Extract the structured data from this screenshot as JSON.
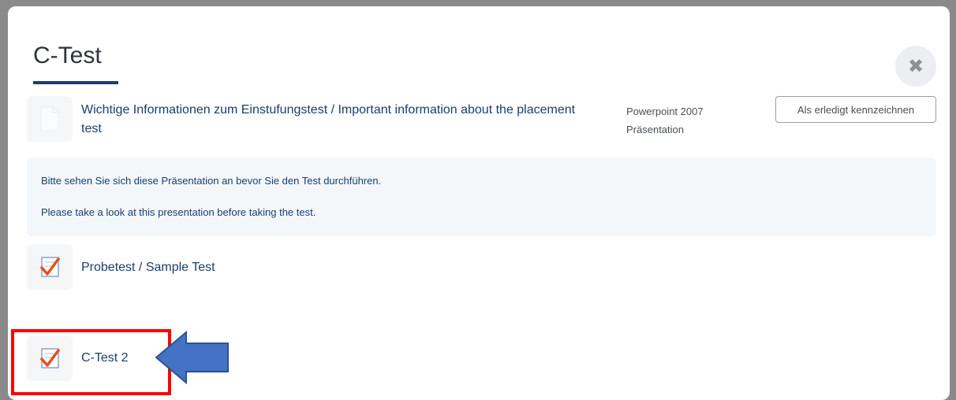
{
  "modal": {
    "title": "C-Test",
    "close_icon": "close-icon"
  },
  "activities": [
    {
      "icon": "powerpoint-file-icon",
      "title": "Wichtige Informationen zum Einstufungstest / Important information about the placement test",
      "meta_line1": "Powerpoint 2007",
      "meta_line2": "Präsentation",
      "button_label": "Als erledigt kennzeichnen",
      "description": [
        "Bitte sehen Sie sich diese Präsentation an bevor Sie den Test durchführen.",
        "Please take a look at this presentation before taking the test."
      ]
    },
    {
      "icon": "quiz-icon",
      "title": "Probetest / Sample Test"
    },
    {
      "icon": "quiz-icon",
      "title": "C-Test 2"
    }
  ],
  "annotations": {
    "highlight_color": "#ff0000",
    "arrow_color": "#4472c4",
    "arrow_icon": "left-arrow-icon"
  }
}
